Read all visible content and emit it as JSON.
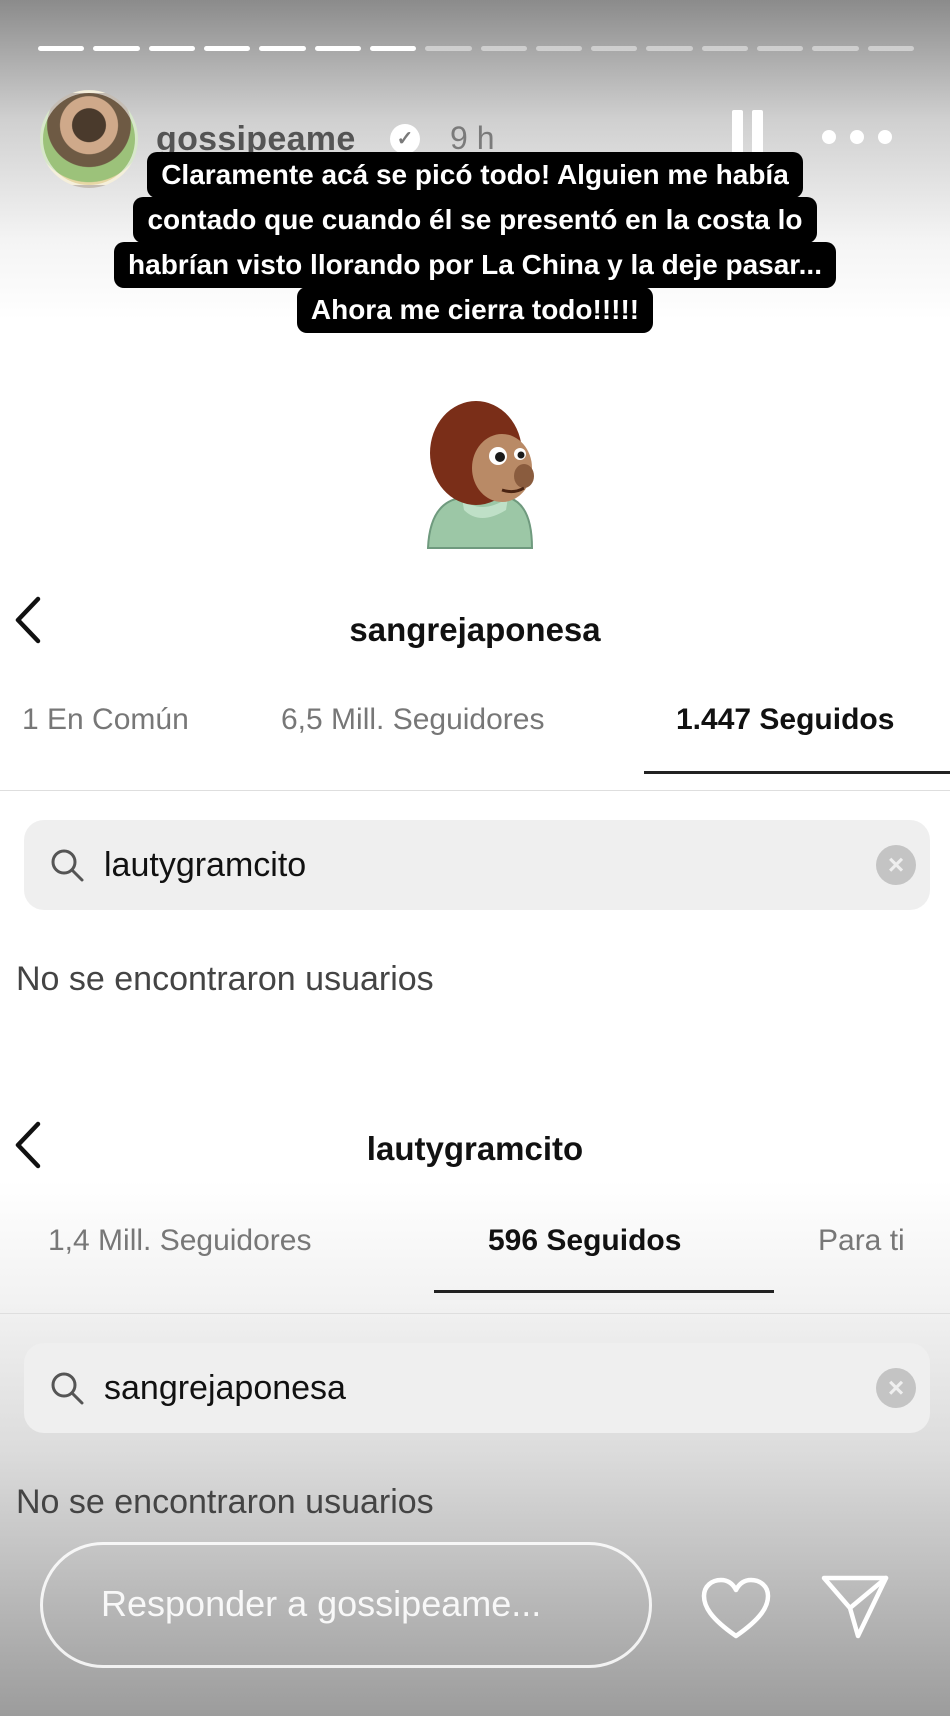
{
  "story": {
    "username": "gossipeame",
    "time": "9 h",
    "caption_lines": [
      "Claramente acá se picó todo! Alguien me había",
      "contado que cuando él se presentó en la costa lo",
      "habrían visto llorando por La China y la deje pasar...",
      "Ahora me cierra todo!!!!!"
    ],
    "reply_placeholder": "Responder a gossipeame..."
  },
  "panel1": {
    "title": "sangrejaponesa",
    "tabs": [
      "1 En Común",
      "6,5 Mill. Seguidores",
      "1.447 Seguidos"
    ],
    "active_tab": "1.447 Seguidos",
    "search_value": "lautygramcito",
    "empty_text": "No se encontraron usuarios"
  },
  "panel2": {
    "title": "lautygramcito",
    "tabs": [
      "1,4 Mill. Seguidores",
      "596 Seguidos",
      "Para ti"
    ],
    "active_tab": "596 Seguidos",
    "search_value": "sangrejaponesa",
    "empty_text": "No se encontraron usuarios"
  },
  "icons": {
    "verified": "verified-badge-icon",
    "pause": "pause-icon",
    "more": "more-icon",
    "back": "back-chevron-icon",
    "search": "search-icon",
    "clear": "clear-icon",
    "heart": "heart-icon",
    "send": "send-icon"
  }
}
